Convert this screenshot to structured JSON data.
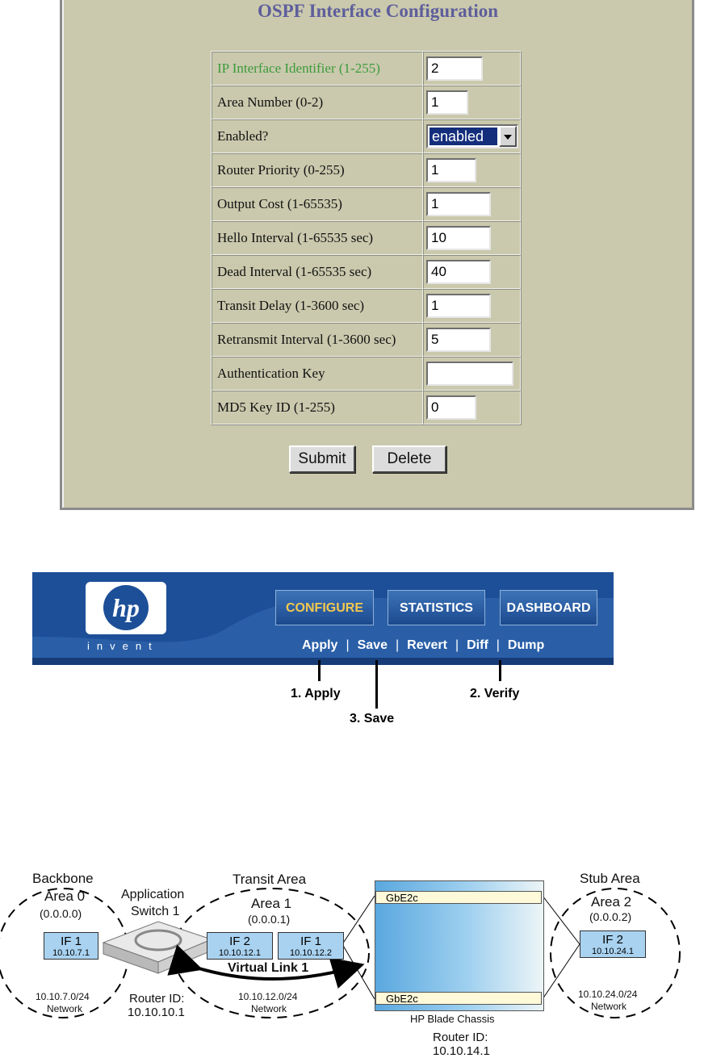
{
  "form": {
    "title": "OSPF Interface Configuration",
    "rows": [
      {
        "label": "IP Interface Identifier  (1-255)",
        "value": "2"
      },
      {
        "label": "Area Number  (0-2)",
        "value": "1"
      },
      {
        "label": "Enabled?",
        "value": "enabled"
      },
      {
        "label": "Router Priority (0-255)",
        "value": "1"
      },
      {
        "label": "Output Cost (1-65535)",
        "value": "1"
      },
      {
        "label": "Hello Interval (1-65535 sec)",
        "value": "10"
      },
      {
        "label": "Dead Interval (1-65535 sec)",
        "value": "40"
      },
      {
        "label": "Transit Delay (1-3600 sec)",
        "value": "1"
      },
      {
        "label": "Retransmit Interval (1-3600 sec)",
        "value": "5"
      },
      {
        "label": "Authentication Key",
        "value": ""
      },
      {
        "label": "MD5 Key ID (1-255)",
        "value": "0"
      }
    ],
    "submit_label": "Submit",
    "delete_label": "Delete",
    "label_color": "#3c9b3c",
    "title_color": "#5e5e9c"
  },
  "banner": {
    "logo_text": "hp",
    "tagline": "invent",
    "tabs": [
      {
        "label": "CONFIGURE",
        "active": true
      },
      {
        "label": "STATISTICS",
        "active": false
      },
      {
        "label": "DASHBOARD",
        "active": false
      }
    ],
    "actions": [
      "Apply",
      "Save",
      "Revert",
      "Diff",
      "Dump"
    ],
    "separator": "|",
    "callouts": [
      "1. Apply",
      "2. Verify",
      "3. Save"
    ],
    "brand_color": "#1d4f98",
    "active_color": "#f4c94e"
  },
  "diagram": {
    "backbone": {
      "title": "Backbone",
      "area": "Area 0",
      "area_id": "(0.0.0.0)",
      "network": "10.10.7.0/24",
      "network_label": "Network"
    },
    "switch": {
      "name_line1": "Application",
      "name_line2": "Switch 1",
      "router_id_label": "Router ID:",
      "router_id": "10.10.10.1"
    },
    "transit": {
      "title": "Transit Area",
      "area": "Area 1",
      "area_id": "(0.0.0.1)",
      "network": "10.10.12.0/24",
      "network_label": "Network"
    },
    "stub": {
      "title": "Stub Area",
      "area": "Area 2",
      "area_id": "(0.0.0.2)",
      "network": "10.10.24.0/24",
      "network_label": "Network"
    },
    "interfaces": [
      {
        "name": "IF 1",
        "ip": "10.10.7.1"
      },
      {
        "name": "IF 2",
        "ip": "10.10.12.1"
      },
      {
        "name": "IF 1",
        "ip": "10.10.12.2"
      },
      {
        "name": "IF 2",
        "ip": "10.10.24.1"
      }
    ],
    "virtual_link": "Virtual Link 1",
    "chassis": {
      "module_top": "GbE2c",
      "module_bottom": "GbE2c",
      "name": "HP Blade Chassis",
      "router_id_label": "Router ID:",
      "router_id": "10.10.14.1"
    }
  }
}
